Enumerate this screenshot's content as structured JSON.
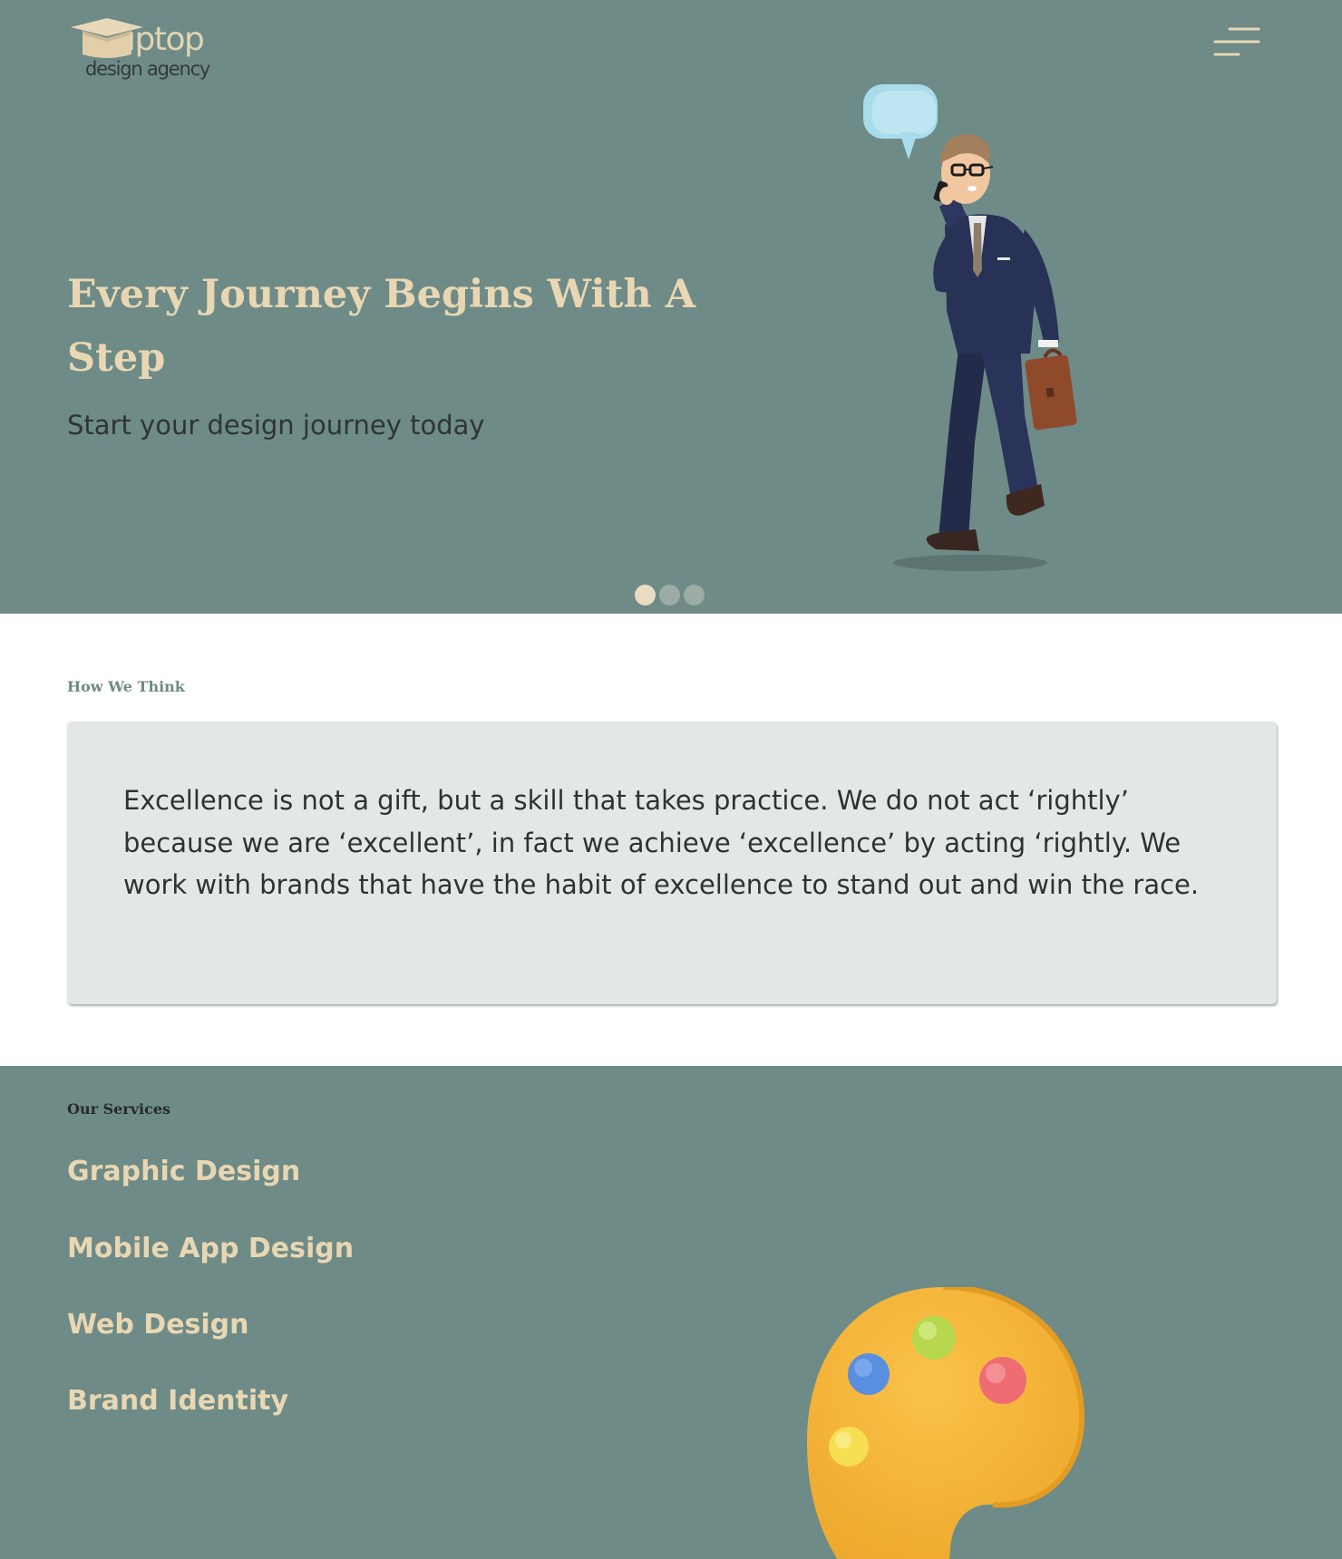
{
  "brand": {
    "name": "iptop",
    "tagline": "design agency",
    "icon": "graduation-cap-icon"
  },
  "menu": {
    "icon": "hamburger-menu-icon"
  },
  "hero": {
    "title": "Every Journey Begins With A Step",
    "subtitle": "Start your design journey today",
    "slides": {
      "count": 3,
      "active": 1
    }
  },
  "think": {
    "label": "How We Think",
    "quote": "Excellence is not a gift, but a skill that takes practice. We do not act ‘rightly’ because we are ‘excellent’, in fact we achieve ‘excellence’ by acting ‘rightly. We work with brands that have the habit of excellence to stand out and win the race."
  },
  "services": {
    "label": "Our Services",
    "items": [
      {
        "label": "Graphic Design"
      },
      {
        "label": "Mobile App Design"
      },
      {
        "label": "Web Design"
      },
      {
        "label": "Brand Identity"
      }
    ]
  },
  "colors": {
    "sage": "#6e8b87",
    "cream": "#e9d7b3",
    "quote_bg": "#e3e8e7",
    "dark_text": "#2e3332"
  }
}
